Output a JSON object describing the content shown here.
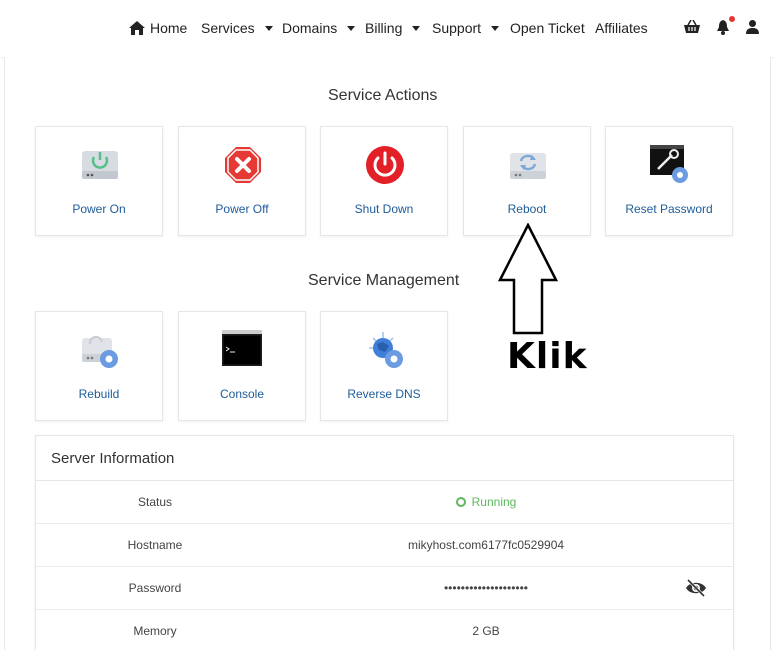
{
  "nav": {
    "home": "Home",
    "services": "Services",
    "domains": "Domains",
    "billing": "Billing",
    "support": "Support",
    "open_ticket": "Open Ticket",
    "affiliates": "Affiliates"
  },
  "service_actions": {
    "title": "Service Actions",
    "items": [
      {
        "label": "Power On",
        "icon": "power-on-icon"
      },
      {
        "label": "Power Off",
        "icon": "power-off-icon"
      },
      {
        "label": "Shut Down",
        "icon": "shutdown-icon"
      },
      {
        "label": "Reboot",
        "icon": "reboot-icon"
      },
      {
        "label": "Reset Password",
        "icon": "reset-password-icon"
      }
    ]
  },
  "service_management": {
    "title": "Service Management",
    "items": [
      {
        "label": "Rebuild",
        "icon": "rebuild-icon"
      },
      {
        "label": "Console",
        "icon": "console-icon"
      },
      {
        "label": "Reverse DNS",
        "icon": "reverse-dns-icon"
      }
    ]
  },
  "annotation": {
    "text": "Klik"
  },
  "server_info": {
    "title": "Server Information",
    "rows": [
      {
        "label": "Status",
        "value": "Running"
      },
      {
        "label": "Hostname",
        "value": "mikyhost.com6177fc0529904"
      },
      {
        "label": "Password",
        "value": "••••••••••••••••••••"
      },
      {
        "label": "Memory",
        "value": "2 GB"
      }
    ]
  },
  "colors": {
    "link": "#1e5c99",
    "running": "#5cb85c",
    "notification": "#e53935"
  }
}
